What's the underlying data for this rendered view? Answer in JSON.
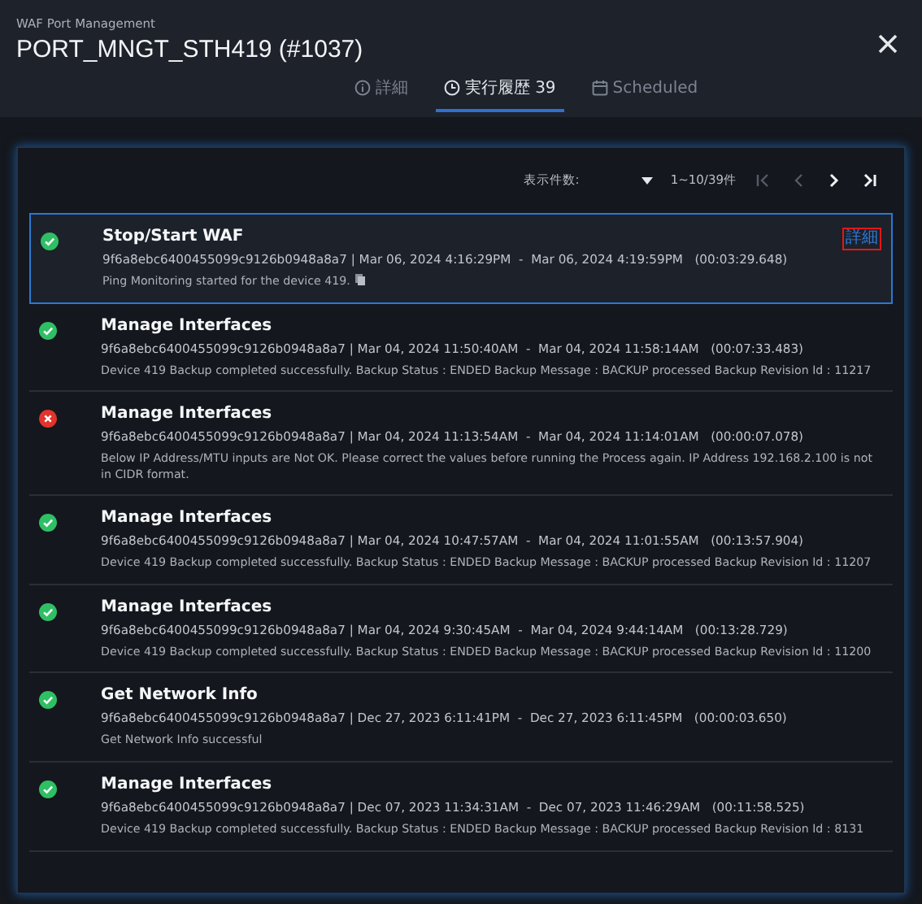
{
  "window": {
    "subtitle": "WAF Port Management",
    "title": "PORT_MNGT_STH419 (#1037)"
  },
  "tabs": [
    {
      "label": "詳細",
      "selected": false
    },
    {
      "label": "実行履歴 39",
      "selected": true
    },
    {
      "label": "Scheduled",
      "selected": false
    }
  ],
  "pagination": {
    "page_size_label": "表示件数:",
    "range": "1~10/39件"
  },
  "runs": [
    {
      "kind": "success",
      "title": "Stop/Start WAF",
      "meta": "9f6a8ebc6400455099c9126b0948a8a7 | Mar 06, 2024 4:16:29PM  -  Mar 06, 2024 4:19:59PM   (00:03:29.648)",
      "message": "Ping Monitoring started for the device 419.",
      "copy": true,
      "selected": true,
      "detail_link": "詳細"
    },
    {
      "kind": "success",
      "title": "Manage Interfaces",
      "meta": "9f6a8ebc6400455099c9126b0948a8a7 | Mar 04, 2024 11:50:40AM  -  Mar 04, 2024 11:58:14AM   (00:07:33.483)",
      "message": "Device 419 Backup completed successfully. Backup Status : ENDED Backup Message : BACKUP processed Backup Revision Id : 11217",
      "selected": false
    },
    {
      "kind": "error",
      "title": "Manage Interfaces",
      "meta": "9f6a8ebc6400455099c9126b0948a8a7 | Mar 04, 2024 11:13:54AM  -  Mar 04, 2024 11:14:01AM   (00:00:07.078)",
      "message": "Below IP Address/MTU inputs are Not OK. Please correct the values before running the Process again. IP Address 192.168.2.100 is not in CIDR format.",
      "selected": false
    },
    {
      "kind": "success",
      "title": "Manage Interfaces",
      "meta": "9f6a8ebc6400455099c9126b0948a8a7 | Mar 04, 2024 10:47:57AM  -  Mar 04, 2024 11:01:55AM   (00:13:57.904)",
      "message": "Device 419 Backup completed successfully. Backup Status : ENDED Backup Message : BACKUP processed Backup Revision Id : 11207",
      "selected": false
    },
    {
      "kind": "success",
      "title": "Manage Interfaces",
      "meta": "9f6a8ebc6400455099c9126b0948a8a7 | Mar 04, 2024 9:30:45AM  -  Mar 04, 2024 9:44:14AM   (00:13:28.729)",
      "message": "Device 419 Backup completed successfully. Backup Status : ENDED Backup Message : BACKUP processed Backup Revision Id : 11200",
      "selected": false
    },
    {
      "kind": "success",
      "title": "Get Network Info",
      "meta": "9f6a8ebc6400455099c9126b0948a8a7 | Dec 27, 2023 6:11:41PM  -  Dec 27, 2023 6:11:45PM   (00:00:03.650)",
      "message": "Get Network Info successful",
      "selected": false
    },
    {
      "kind": "success",
      "title": "Manage Interfaces",
      "meta": "9f6a8ebc6400455099c9126b0948a8a7 | Dec 07, 2023 11:34:31AM  -  Dec 07, 2023 11:46:29AM   (00:11:58.525)",
      "message": "Device 419 Backup completed successfully. Backup Status : ENDED Backup Message : BACKUP processed Backup Revision Id : 8131",
      "selected": false
    }
  ]
}
